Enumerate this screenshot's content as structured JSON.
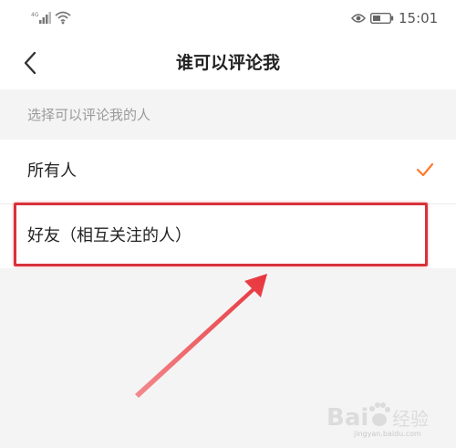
{
  "status_bar": {
    "signal": "4G",
    "time": "15:01",
    "icons": [
      "signal-icon",
      "wifi-icon",
      "eye-icon",
      "battery-icon"
    ]
  },
  "header": {
    "back_icon": "chevron-left-icon",
    "title": "谁可以评论我"
  },
  "section": {
    "label": "选择可以评论我的人"
  },
  "options": [
    {
      "label": "所有人",
      "selected": true
    },
    {
      "label": "好友（相互关注的人）",
      "selected": false
    }
  ],
  "annotation": {
    "highlight_color": "#d9313a",
    "arrow_color": "#e8353c"
  },
  "watermark": {
    "text": "Bai度 经验",
    "sub": "jingyan.baidu.com"
  },
  "colors": {
    "accent_check": "#ff7a2a",
    "background": "#f4f4f4"
  }
}
